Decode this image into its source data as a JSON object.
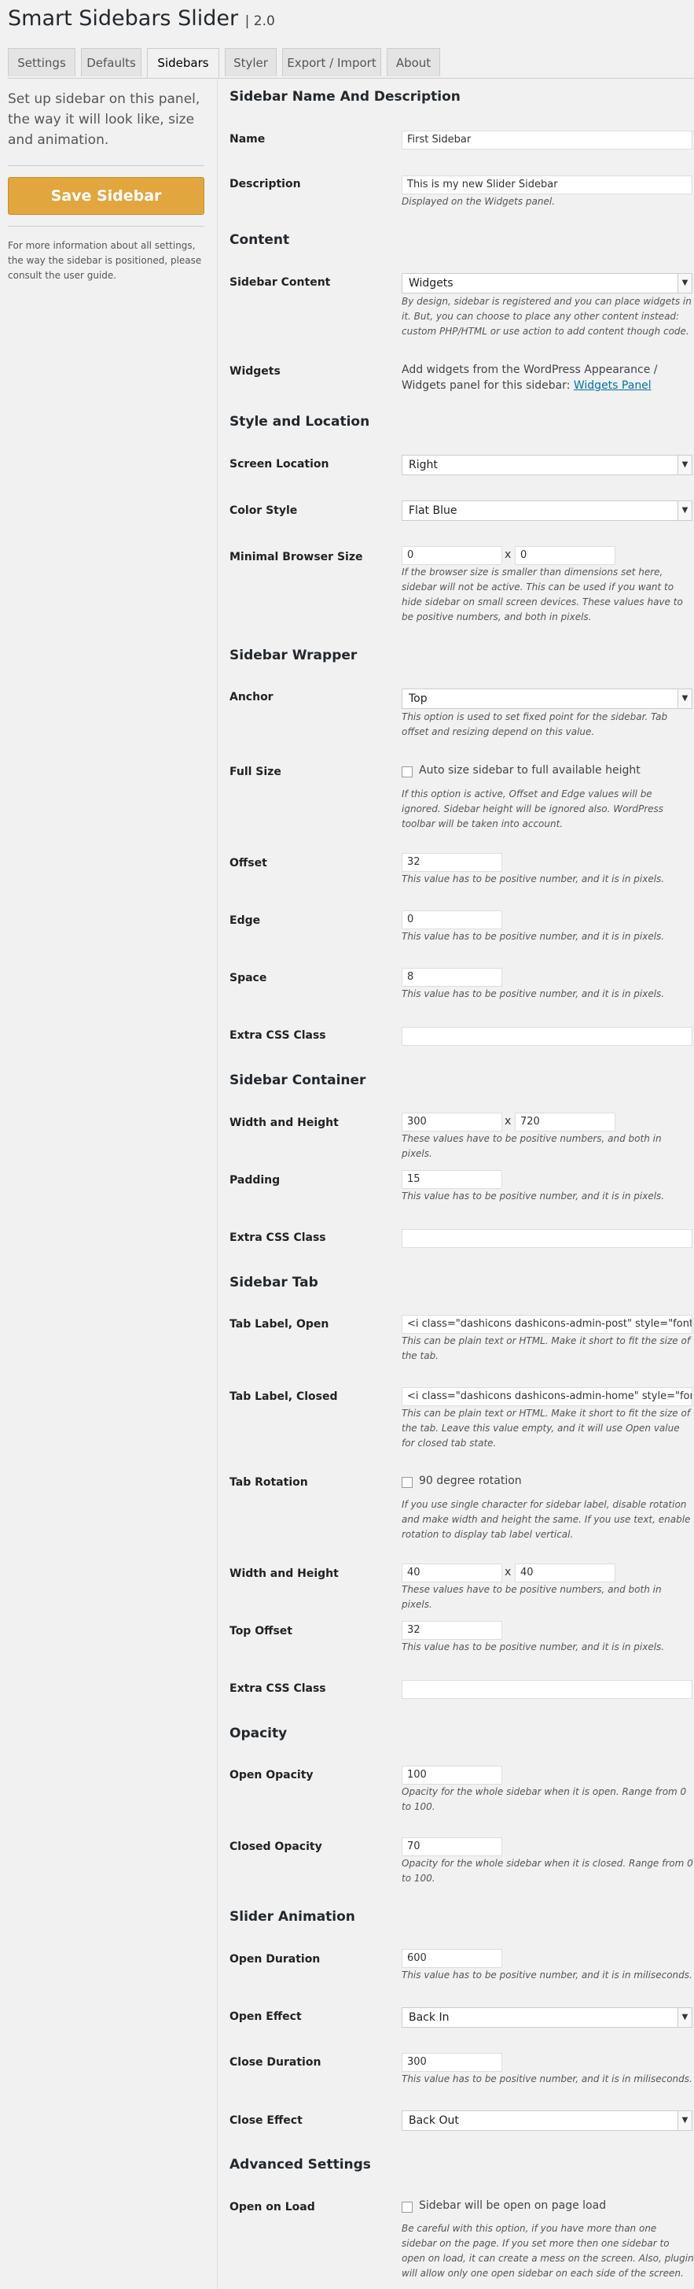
{
  "header": {
    "title": "Smart Sidebars Slider",
    "version": "| 2.0"
  },
  "tabs": [
    "Settings",
    "Defaults",
    "Sidebars",
    "Styler",
    "Export / Import",
    "About"
  ],
  "sidebar": {
    "intro": "Set up sidebar on this panel, the way it will look like, size and animation.",
    "save_label": "Save Sidebar",
    "note": "For more information about all settings, the way the sidebar is positioned, please consult the user guide."
  },
  "sections": {
    "name_desc": "Sidebar Name And Description",
    "content": "Content",
    "style_location": "Style and Location",
    "wrapper": "Sidebar Wrapper",
    "container": "Sidebar Container",
    "tab": "Sidebar Tab",
    "opacity": "Opacity",
    "animation": "Slider Animation",
    "advanced": "Advanced Settings"
  },
  "fields": {
    "name": {
      "label": "Name",
      "value": "First Sidebar"
    },
    "description": {
      "label": "Description",
      "value": "This is my new Slider Sidebar",
      "help": "Displayed on the Widgets panel."
    },
    "sidebar_content": {
      "label": "Sidebar Content",
      "value": "Widgets",
      "help": "By design, sidebar is registered and you can place widgets in it. But, you can choose to place any other content instead: custom PHP/HTML or use action to add content though code."
    },
    "widgets": {
      "label": "Widgets",
      "text": "Add widgets from the WordPress Appearance / Widgets panel for this sidebar:",
      "link": "Widgets Panel"
    },
    "screen_location": {
      "label": "Screen Location",
      "value": "Right"
    },
    "color_style": {
      "label": "Color Style",
      "value": "Flat Blue"
    },
    "min_browser": {
      "label": "Minimal Browser Size",
      "w": "0",
      "h": "0",
      "help": "If the browser size is smaller than dimensions set here, sidebar will not be active. This can be used if you want to hide sidebar on small screen devices. These values have to be positive numbers, and both in pixels."
    },
    "anchor": {
      "label": "Anchor",
      "value": "Top",
      "help": "This option is used to set fixed point for the sidebar. Tab offset and resizing depend on this value."
    },
    "full_size": {
      "label": "Full Size",
      "check": "Auto size sidebar to full available height",
      "help": "If this option is active, Offset and Edge values will be ignored. Sidebar height will be ignored also. WordPress toolbar will be taken into account."
    },
    "offset": {
      "label": "Offset",
      "value": "32",
      "help": "This value has to be positive number, and it is in pixels."
    },
    "edge": {
      "label": "Edge",
      "value": "0",
      "help": "This value has to be positive number, and it is in pixels."
    },
    "space": {
      "label": "Space",
      "value": "8",
      "help": "This value has to be positive number, and it is in pixels."
    },
    "wrapper_css": {
      "label": "Extra CSS Class",
      "value": ""
    },
    "container_size": {
      "label": "Width and Height",
      "w": "300",
      "h": "720",
      "help": "These values have to be positive numbers, and both in pixels."
    },
    "padding": {
      "label": "Padding",
      "value": "15",
      "help": "This value has to be positive number, and it is in pixels."
    },
    "container_css": {
      "label": "Extra CSS Class",
      "value": ""
    },
    "tab_open": {
      "label": "Tab Label, Open",
      "value": "<i class=\"dashicons dashicons-admin-post\" style=\"font-",
      "help": "This can be plain text or HTML. Make it short to fit the size of the tab."
    },
    "tab_closed": {
      "label": "Tab Label, Closed",
      "value": "<i class=\"dashicons dashicons-admin-home\" style=\"fon",
      "help": "This can be plain text or HTML. Make it short to fit the size of the tab. Leave this value empty, and it will use Open value for closed tab state."
    },
    "tab_rotation": {
      "label": "Tab Rotation",
      "check": "90 degree rotation",
      "help": "If you use single character for sidebar label, disable rotation and make width and height the same. If you use text, enable rotation to display tab label vertical."
    },
    "tab_size": {
      "label": "Width and Height",
      "w": "40",
      "h": "40",
      "help": "These values have to be positive numbers, and both in pixels."
    },
    "top_offset": {
      "label": "Top Offset",
      "value": "32",
      "help": "This value has to be positive number, and it is in pixels."
    },
    "tab_css": {
      "label": "Extra CSS Class",
      "value": ""
    },
    "open_opacity": {
      "label": "Open Opacity",
      "value": "100",
      "help": "Opacity for the whole sidebar when it is open. Range from 0 to 100."
    },
    "closed_opacity": {
      "label": "Closed Opacity",
      "value": "70",
      "help": "Opacity for the whole sidebar when it is closed. Range from 0 to 100."
    },
    "open_duration": {
      "label": "Open Duration",
      "value": "600",
      "help": "This value has to be positive number, and it is in miliseconds."
    },
    "open_effect": {
      "label": "Open Effect",
      "value": "Back In"
    },
    "close_duration": {
      "label": "Close Duration",
      "value": "300",
      "help": "This value has to be positive number, and it is in miliseconds."
    },
    "close_effect": {
      "label": "Close Effect",
      "value": "Back Out"
    },
    "open_on_load": {
      "label": "Open on Load",
      "check": "Sidebar will be open on page load",
      "help": "Be careful with this option, if you have more than one sidebar on the page. If you set more then one sidebar to open on load, it can create a mess on the screen. Also, plugin will allow only one open sidebar on each side of the screen."
    }
  },
  "x_sep": "x",
  "select_arrow": "▼"
}
